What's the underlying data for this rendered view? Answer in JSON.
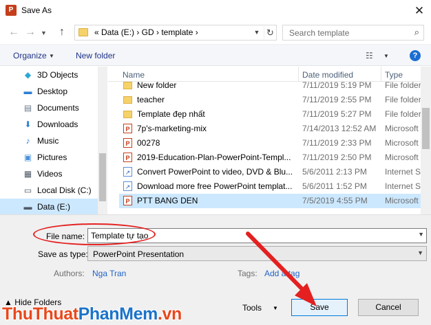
{
  "window": {
    "title": "Save As",
    "app_icon": "P"
  },
  "address": {
    "breadcrumb": "«  Data (E:)  ›  GD  ›  template  ›",
    "search_placeholder": "Search template"
  },
  "toolbar": {
    "organize": "Organize",
    "new_folder": "New folder",
    "view_icon": "details-view-icon",
    "help": "?"
  },
  "nav": {
    "items": [
      {
        "label": "3D Objects",
        "icon": "3d-objects-icon",
        "glyph": "◆",
        "color": "#2aa7d8"
      },
      {
        "label": "Desktop",
        "icon": "desktop-icon",
        "glyph": "▬",
        "color": "#2b7fd6"
      },
      {
        "label": "Documents",
        "icon": "documents-icon",
        "glyph": "▤",
        "color": "#6d7b8d"
      },
      {
        "label": "Downloads",
        "icon": "downloads-icon",
        "glyph": "⬇",
        "color": "#2b7fd6"
      },
      {
        "label": "Music",
        "icon": "music-icon",
        "glyph": "♪",
        "color": "#2b7fd6"
      },
      {
        "label": "Pictures",
        "icon": "pictures-icon",
        "glyph": "▣",
        "color": "#4a90d9"
      },
      {
        "label": "Videos",
        "icon": "videos-icon",
        "glyph": "▦",
        "color": "#505a66"
      },
      {
        "label": "Local Disk (C:)",
        "icon": "local-disk-icon",
        "glyph": "▭",
        "color": "#505a66"
      },
      {
        "label": "Data (E:)",
        "icon": "drive-icon",
        "glyph": "▬",
        "color": "#505a66",
        "selected": true
      }
    ]
  },
  "files": {
    "columns": [
      "Name",
      "Date modified",
      "Type"
    ],
    "rows": [
      {
        "name": "New folder",
        "date": "7/11/2019 5:19 PM",
        "type": "File folder",
        "kind": "folder"
      },
      {
        "name": "teacher",
        "date": "7/11/2019 2:55 PM",
        "type": "File folder",
        "kind": "folder"
      },
      {
        "name": "Template đẹp nhất",
        "date": "7/11/2019 5:27 PM",
        "type": "File folder",
        "kind": "folder"
      },
      {
        "name": "7p's-marketing-mix",
        "date": "7/14/2013 12:52 AM",
        "type": "Microsoft",
        "kind": "ppt"
      },
      {
        "name": "00278",
        "date": "7/11/2019 2:33 PM",
        "type": "Microsoft",
        "kind": "ppt"
      },
      {
        "name": "2019-Education-Plan-PowerPoint-Templ...",
        "date": "7/11/2019 2:50 PM",
        "type": "Microsoft",
        "kind": "ppt"
      },
      {
        "name": "Convert PowerPoint to video, DVD & Blu...",
        "date": "5/6/2011 2:13 PM",
        "type": "Internet S",
        "kind": "link"
      },
      {
        "name": "Download more free PowerPoint templat...",
        "date": "5/6/2011 1:52 PM",
        "type": "Internet S",
        "kind": "link"
      },
      {
        "name": "PTT BANG DEN",
        "date": "7/5/2019 4:55 PM",
        "type": "Microsoft",
        "kind": "ppt",
        "selected": true
      }
    ]
  },
  "form": {
    "filename_label": "File name:",
    "filename_value": "Template tự tạo",
    "saveas_label": "Save as type:",
    "saveas_value": "PowerPoint Presentation",
    "authors_label": "Authors:",
    "authors_value": "Nga Tran",
    "tags_label": "Tags:",
    "tags_value": "Add a tag"
  },
  "buttons": {
    "tools": "Tools",
    "save": "Save",
    "cancel": "Cancel",
    "hide_folders": "▲  Hide Folders"
  },
  "watermark": {
    "part1": "ThuThuat",
    "part2": "PhanMem",
    "part3": ".vn",
    "color1": "#e8481c",
    "color2": "#1b73c8"
  }
}
